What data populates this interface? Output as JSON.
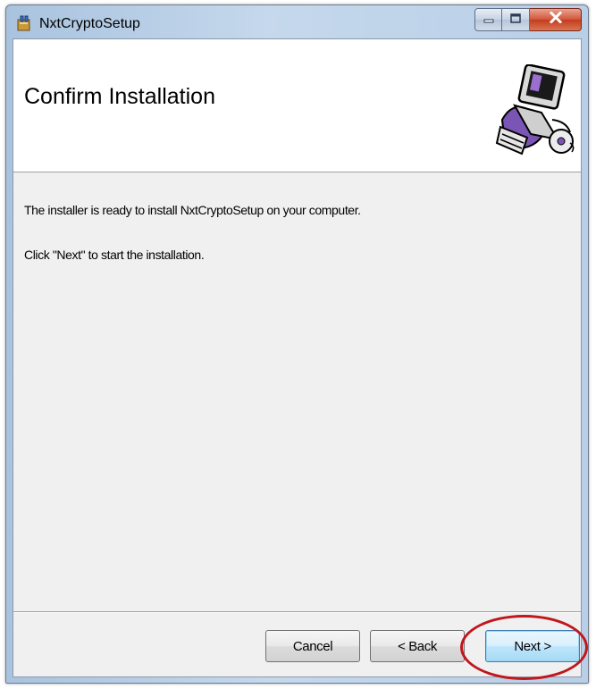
{
  "window": {
    "title": "NxtCryptoSetup"
  },
  "header": {
    "title": "Confirm Installation",
    "graphic_icon": "computer-setup-icon"
  },
  "body": {
    "line1": "The installer is ready to install NxtCryptoSetup on your computer.",
    "line2": "Click \"Next\" to start the installation."
  },
  "buttons": {
    "cancel": "Cancel",
    "back": "< Back",
    "next": "Next >"
  },
  "annotation": {
    "highlight_color": "#c0161c",
    "highlighted_element": "next-button"
  },
  "colors": {
    "titlebar": "#b9cfe7",
    "close_button": "#c43c1f",
    "dialog_background": "#f0f0f0"
  }
}
